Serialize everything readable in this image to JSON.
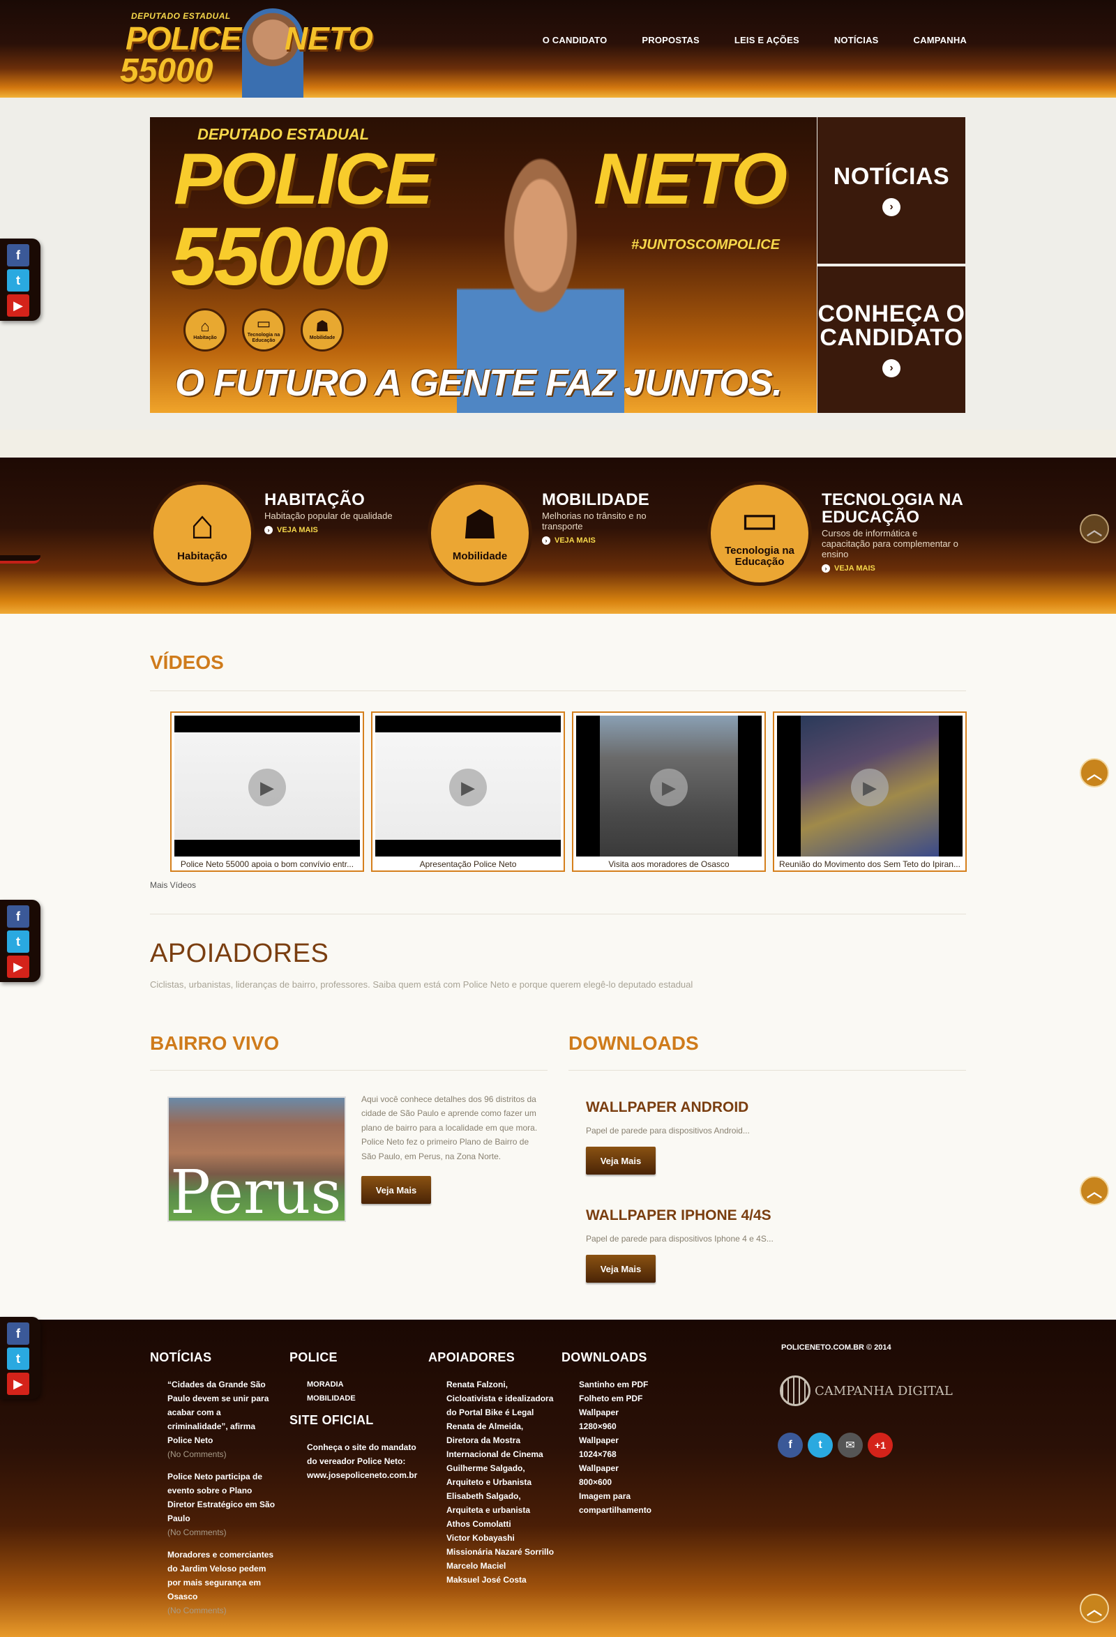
{
  "header": {
    "logo": {
      "dep": "DEPUTADO ESTADUAL",
      "police": "POLICE",
      "neto": "NETO",
      "num": "55000"
    },
    "nav": [
      "O CANDIDATO",
      "PROPOSTAS",
      "LEIS E AÇÕES",
      "NOTÍCIAS",
      "CAMPANHA"
    ]
  },
  "hero": {
    "dep": "DEPUTADO ESTADUAL",
    "police": "POLICE",
    "neto": "NETO",
    "num": "55000",
    "hashtag": "#JUNTOSCOMPOLICE",
    "slogan": "O FUTURO A GENTE FAZ JUNTOS.",
    "mini_icons": [
      {
        "label": "Habitação",
        "icon": "house-icon"
      },
      {
        "label": "Tecnologia na Educação",
        "icon": "computer-icon"
      },
      {
        "label": "Mobilidade",
        "icon": "walking-person-icon"
      }
    ],
    "panels": [
      {
        "title": "NOTÍCIAS",
        "icon": "arrow-right-icon"
      },
      {
        "title": "CONHEÇA O CANDIDATO",
        "icon": "arrow-right-icon"
      }
    ]
  },
  "features": [
    {
      "circle_label": "Habitação",
      "icon": "house-icon",
      "title": "HABITAÇÃO",
      "desc": "Habitação popular de qualidade",
      "more": "VEJA MAIS"
    },
    {
      "circle_label": "Mobilidade",
      "icon": "walking-person-icon",
      "title": "MOBILIDADE",
      "desc": "Melhorias no trânsito e no transporte",
      "more": "VEJA MAIS"
    },
    {
      "circle_label": "Tecnologia na Educação",
      "icon": "computer-icon",
      "title": "TECNOLOGIA NA EDUCAÇÃO",
      "desc": "Cursos de informática e capacitação para complementar o ensino",
      "more": "VEJA MAIS"
    }
  ],
  "videos": {
    "title": "VÍDEOS",
    "items": [
      {
        "caption": "Police Neto 55000 apoia o bom convívio entr..."
      },
      {
        "caption": "Apresentação Police Neto"
      },
      {
        "caption": "Visita aos moradores de Osasco"
      },
      {
        "caption": "Reunião do Movimento dos Sem Teto do Ipiran..."
      }
    ],
    "more": "Mais Vídeos"
  },
  "apoiadores": {
    "title": "APOIADORES",
    "subtitle": "Ciclistas, urbanistas, lideranças de bairro, professores. Saiba quem está com Police Neto e porque querem elegê-lo deputado estadual"
  },
  "bairro": {
    "title": "BAIRRO VIVO",
    "image_word": "Perus",
    "text": "Aqui você conhece detalhes dos 96 distritos da cidade de São Paulo e aprende como fazer um plano de bairro para a localidade em que mora. Police Neto fez o primeiro Plano de Bairro de São Paulo, em Perus, na Zona Norte.",
    "button": "Veja Mais"
  },
  "downloads": {
    "title": "DOWNLOADS",
    "items": [
      {
        "title": "WALLPAPER ANDROID",
        "desc": "Papel de parede para dispositivos Android...",
        "button": "Veja Mais"
      },
      {
        "title": "WALLPAPER IPHONE 4/4S",
        "desc": "Papel de parede para dispositivos Iphone 4 e 4S...",
        "button": "Veja Mais"
      }
    ]
  },
  "footer": {
    "noticias": {
      "title": "NOTÍCIAS",
      "items": [
        {
          "text": "“Cidades da Grande São Paulo devem se unir para acabar com a criminalidade”, afirma Police Neto",
          "comments": "(No Comments)"
        },
        {
          "text": "Police Neto participa de evento sobre o Plano Diretor Estratégico em São Paulo",
          "comments": "(No Comments)"
        },
        {
          "text": "Moradores e comerciantes do Jardim Veloso pedem por mais segurança em Osasco",
          "comments": "(No Comments)"
        }
      ]
    },
    "police": {
      "title": "POLICE",
      "items": [
        "MORADIA",
        "MOBILIDADE"
      ]
    },
    "site": {
      "title": "SITE OFICIAL",
      "text": "Conheça o site do mandato do vereador Police Neto: www.josepoliceneto.com.br"
    },
    "apoiadores": {
      "title": "APOIADORES",
      "items": [
        "Renata Falzoni,",
        "Cicloativista e idealizadora",
        "do Portal Bike é Legal",
        "Renata de Almeida,",
        "Diretora da Mostra",
        "Internacional de Cinema",
        "Guilherme Salgado,",
        "Arquiteto e Urbanista",
        "Elisabeth Salgado,",
        "Arquiteta e urbanista",
        "Athos Comolatti",
        "Victor Kobayashi",
        "Missionária Nazaré Sorrillo",
        "Marcelo Maciel",
        "Maksuel José Costa"
      ]
    },
    "downloads": {
      "title": "DOWNLOADS",
      "items": [
        "Santinho em PDF",
        "Folheto em PDF",
        "Wallpaper",
        "1280×960",
        "Wallpaper",
        "1024×768",
        "Wallpaper",
        "800×600",
        "Imagem para",
        "compartilhamento"
      ]
    },
    "copyright": "POLICENETO.COM.BR © 2014",
    "agency": "CAMPANHA DIGITAL",
    "share": [
      {
        "icon": "facebook-icon",
        "glyph": "f",
        "color": "#3b5998"
      },
      {
        "icon": "twitter-icon",
        "glyph": "t",
        "color": "#2aa9e0"
      },
      {
        "icon": "email-icon",
        "glyph": "✉",
        "color": "#555555"
      },
      {
        "icon": "google-plus-icon",
        "glyph": "+1",
        "color": "#d4231a"
      }
    ]
  },
  "social_side": {
    "facebook": "f",
    "twitter": "t",
    "youtube": "▶"
  }
}
